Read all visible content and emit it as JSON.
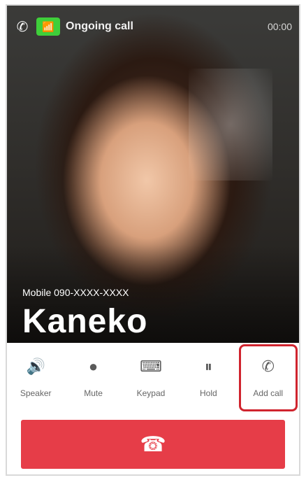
{
  "status": {
    "call_icon": "call-icon",
    "wifi_icon": "wifi-call-icon",
    "provider_text": "Ongoing call",
    "timer_text": "00:00"
  },
  "caller": {
    "subtitle": "Mobile 090-XXXX-XXXX",
    "name": "Kaneko"
  },
  "controls": [
    {
      "id": "speaker",
      "label": "Speaker",
      "icon": "speaker-icon"
    },
    {
      "id": "mute",
      "label": "Mute",
      "icon": "mute-icon"
    },
    {
      "id": "keypad",
      "label": "Keypad",
      "icon": "keypad-icon"
    },
    {
      "id": "hold",
      "label": "Hold",
      "icon": "pause-icon"
    },
    {
      "id": "add",
      "label": "Add call",
      "icon": "add-call-icon"
    }
  ],
  "end_call": {
    "icon": "end-call-icon"
  },
  "colors": {
    "end_call": "#e63d48",
    "highlight": "#d0242e",
    "wifi": "#3fcf3a"
  }
}
